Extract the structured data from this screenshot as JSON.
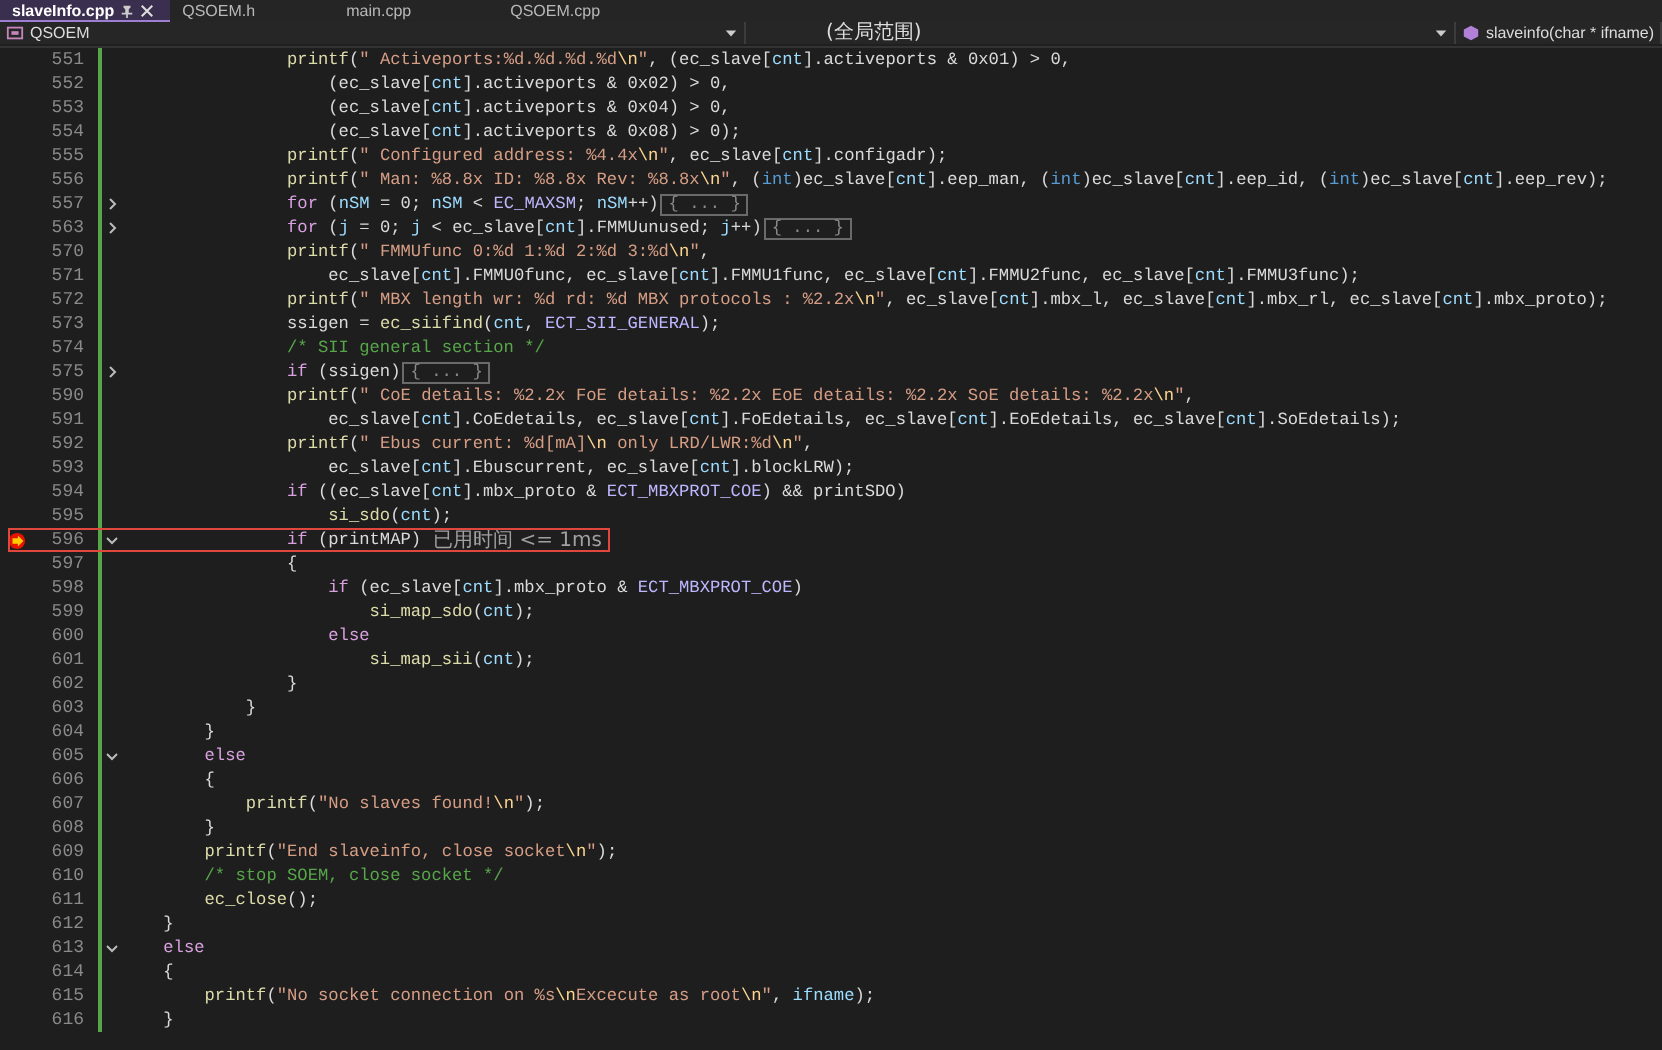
{
  "tabs": [
    {
      "label": "slaveInfo.cpp",
      "selected": true
    },
    {
      "label": "QSOEM.h",
      "selected": false
    },
    {
      "label": "main.cpp",
      "selected": false
    },
    {
      "label": "QSOEM.cpp",
      "selected": false
    }
  ],
  "navigation_bar": {
    "project": "QSOEM",
    "scope": "(全局范围)",
    "member": "slaveinfo(char * ifname)"
  },
  "editor": {
    "lines": [
      {
        "number": "551",
        "breakpoint": false,
        "highlighted": false,
        "segments": [
          {
            "text": "                printf",
            "kind": "f"
          },
          {
            "text": "(",
            "kind": "p"
          },
          {
            "text": "\" Activeports:%d.%d.%d.%d",
            "kind": "s"
          },
          {
            "text": "\\n",
            "kind": "e"
          },
          {
            "text": "\"",
            "kind": "s"
          },
          {
            "text": ", (ec_slave[",
            "kind": "p"
          },
          {
            "text": "cnt",
            "kind": "v"
          },
          {
            "text": "].activeports & 0x01) > 0,",
            "kind": "p"
          }
        ]
      },
      {
        "number": "552",
        "breakpoint": false,
        "highlighted": false,
        "segments": [
          {
            "text": "                    (ec_slave[",
            "kind": "p"
          },
          {
            "text": "cnt",
            "kind": "v"
          },
          {
            "text": "].activeports & 0x02) > 0,",
            "kind": "p"
          }
        ]
      },
      {
        "number": "553",
        "breakpoint": false,
        "highlighted": false,
        "segments": [
          {
            "text": "                    (ec_slave[",
            "kind": "p"
          },
          {
            "text": "cnt",
            "kind": "v"
          },
          {
            "text": "].activeports & 0x04) > 0,",
            "kind": "p"
          }
        ]
      },
      {
        "number": "554",
        "breakpoint": false,
        "highlighted": false,
        "segments": [
          {
            "text": "                    (ec_slave[",
            "kind": "p"
          },
          {
            "text": "cnt",
            "kind": "v"
          },
          {
            "text": "].activeports & 0x08) > 0);",
            "kind": "p"
          }
        ]
      },
      {
        "number": "555",
        "breakpoint": false,
        "highlighted": false,
        "segments": [
          {
            "text": "                printf",
            "kind": "f"
          },
          {
            "text": "(",
            "kind": "p"
          },
          {
            "text": "\" Configured address: %4.4x",
            "kind": "s"
          },
          {
            "text": "\\n",
            "kind": "e"
          },
          {
            "text": "\"",
            "kind": "s"
          },
          {
            "text": ", ec_slave[",
            "kind": "p"
          },
          {
            "text": "cnt",
            "kind": "v"
          },
          {
            "text": "].configadr);",
            "kind": "p"
          }
        ]
      },
      {
        "number": "556",
        "breakpoint": false,
        "highlighted": false,
        "segments": [
          {
            "text": "                printf",
            "kind": "f"
          },
          {
            "text": "(",
            "kind": "p"
          },
          {
            "text": "\" Man: %8.8x ID: %8.8x Rev: %8.8x",
            "kind": "s"
          },
          {
            "text": "\\n",
            "kind": "e"
          },
          {
            "text": "\"",
            "kind": "s"
          },
          {
            "text": ", (",
            "kind": "p"
          },
          {
            "text": "int",
            "kind": "t"
          },
          {
            "text": ")ec_slave[",
            "kind": "p"
          },
          {
            "text": "cnt",
            "kind": "v"
          },
          {
            "text": "].eep_man, (",
            "kind": "p"
          },
          {
            "text": "int",
            "kind": "t"
          },
          {
            "text": ")ec_slave[",
            "kind": "p"
          },
          {
            "text": "cnt",
            "kind": "v"
          },
          {
            "text": "].eep_id, (",
            "kind": "p"
          },
          {
            "text": "int",
            "kind": "t"
          },
          {
            "text": ")ec_slave[",
            "kind": "p"
          },
          {
            "text": "cnt",
            "kind": "v"
          },
          {
            "text": "].eep_rev);",
            "kind": "p"
          }
        ]
      },
      {
        "number": "557",
        "collapsed": true,
        "breakpoint": false,
        "highlighted": false,
        "segments": [
          {
            "text": "                for",
            "kind": "k"
          },
          {
            "text": " (",
            "kind": "p"
          },
          {
            "text": "nSM",
            "kind": "v"
          },
          {
            "text": " = 0; ",
            "kind": "p"
          },
          {
            "text": "nSM",
            "kind": "v"
          },
          {
            "text": " < ",
            "kind": "p"
          },
          {
            "text": "EC_MAXSM",
            "kind": "m"
          },
          {
            "text": "; ",
            "kind": "p"
          },
          {
            "text": "nSM",
            "kind": "v"
          },
          {
            "text": "++)",
            "kind": "p"
          },
          {
            "text": "{ ... }",
            "kind": "collapsed"
          }
        ]
      },
      {
        "number": "563",
        "collapsed": true,
        "breakpoint": false,
        "highlighted": false,
        "segments": [
          {
            "text": "                for",
            "kind": "k"
          },
          {
            "text": " (",
            "kind": "p"
          },
          {
            "text": "j",
            "kind": "v"
          },
          {
            "text": " = 0; ",
            "kind": "p"
          },
          {
            "text": "j",
            "kind": "v"
          },
          {
            "text": " < ec_slave[",
            "kind": "p"
          },
          {
            "text": "cnt",
            "kind": "v"
          },
          {
            "text": "].FMMUunused; ",
            "kind": "p"
          },
          {
            "text": "j",
            "kind": "v"
          },
          {
            "text": "++)",
            "kind": "p"
          },
          {
            "text": "{ ... }",
            "kind": "collapsed"
          }
        ]
      },
      {
        "number": "570",
        "breakpoint": false,
        "highlighted": false,
        "segments": [
          {
            "text": "                printf",
            "kind": "f"
          },
          {
            "text": "(",
            "kind": "p"
          },
          {
            "text": "\" FMMUfunc 0:%d 1:%d 2:%d 3:%d",
            "kind": "s"
          },
          {
            "text": "\\n",
            "kind": "e"
          },
          {
            "text": "\"",
            "kind": "s"
          },
          {
            "text": ",",
            "kind": "p"
          }
        ]
      },
      {
        "number": "571",
        "breakpoint": false,
        "highlighted": false,
        "segments": [
          {
            "text": "                    ec_slave[",
            "kind": "p"
          },
          {
            "text": "cnt",
            "kind": "v"
          },
          {
            "text": "].FMMU0func, ec_slave[",
            "kind": "p"
          },
          {
            "text": "cnt",
            "kind": "v"
          },
          {
            "text": "].FMMU1func, ec_slave[",
            "kind": "p"
          },
          {
            "text": "cnt",
            "kind": "v"
          },
          {
            "text": "].FMMU2func, ec_slave[",
            "kind": "p"
          },
          {
            "text": "cnt",
            "kind": "v"
          },
          {
            "text": "].FMMU3func);",
            "kind": "p"
          }
        ]
      },
      {
        "number": "572",
        "breakpoint": false,
        "highlighted": false,
        "segments": [
          {
            "text": "                printf",
            "kind": "f"
          },
          {
            "text": "(",
            "kind": "p"
          },
          {
            "text": "\" MBX length wr: %d rd: %d MBX protocols : %2.2x",
            "kind": "s"
          },
          {
            "text": "\\n",
            "kind": "e"
          },
          {
            "text": "\"",
            "kind": "s"
          },
          {
            "text": ", ec_slave[",
            "kind": "p"
          },
          {
            "text": "cnt",
            "kind": "v"
          },
          {
            "text": "].mbx_l, ec_slave[",
            "kind": "p"
          },
          {
            "text": "cnt",
            "kind": "v"
          },
          {
            "text": "].mbx_rl, ec_slave[",
            "kind": "p"
          },
          {
            "text": "cnt",
            "kind": "v"
          },
          {
            "text": "].mbx_proto);",
            "kind": "p"
          }
        ]
      },
      {
        "number": "573",
        "breakpoint": false,
        "highlighted": false,
        "segments": [
          {
            "text": "                ssigen = ",
            "kind": "p"
          },
          {
            "text": "ec_siifind",
            "kind": "f"
          },
          {
            "text": "(",
            "kind": "p"
          },
          {
            "text": "cnt",
            "kind": "v"
          },
          {
            "text": ", ",
            "kind": "p"
          },
          {
            "text": "ECT_SII_GENERAL",
            "kind": "m"
          },
          {
            "text": ");",
            "kind": "p"
          }
        ]
      },
      {
        "number": "574",
        "breakpoint": false,
        "highlighted": false,
        "segments": [
          {
            "text": "                /* SII general section */",
            "kind": "c"
          }
        ]
      },
      {
        "number": "575",
        "collapsed": true,
        "breakpoint": false,
        "highlighted": false,
        "segments": [
          {
            "text": "                if",
            "kind": "k"
          },
          {
            "text": " (ssigen)",
            "kind": "p"
          },
          {
            "text": "{ ... }",
            "kind": "collapsed"
          }
        ]
      },
      {
        "number": "590",
        "breakpoint": false,
        "highlighted": false,
        "segments": [
          {
            "text": "                printf",
            "kind": "f"
          },
          {
            "text": "(",
            "kind": "p"
          },
          {
            "text": "\" CoE details: %2.2x FoE details: %2.2x EoE details: %2.2x SoE details: %2.2x",
            "kind": "s"
          },
          {
            "text": "\\n",
            "kind": "e"
          },
          {
            "text": "\"",
            "kind": "s"
          },
          {
            "text": ",",
            "kind": "p"
          }
        ]
      },
      {
        "number": "591",
        "breakpoint": false,
        "highlighted": false,
        "segments": [
          {
            "text": "                    ec_slave[",
            "kind": "p"
          },
          {
            "text": "cnt",
            "kind": "v"
          },
          {
            "text": "].CoEdetails, ec_slave[",
            "kind": "p"
          },
          {
            "text": "cnt",
            "kind": "v"
          },
          {
            "text": "].FoEdetails, ec_slave[",
            "kind": "p"
          },
          {
            "text": "cnt",
            "kind": "v"
          },
          {
            "text": "].EoEdetails, ec_slave[",
            "kind": "p"
          },
          {
            "text": "cnt",
            "kind": "v"
          },
          {
            "text": "].SoEdetails);",
            "kind": "p"
          }
        ]
      },
      {
        "number": "592",
        "breakpoint": false,
        "highlighted": false,
        "segments": [
          {
            "text": "                printf",
            "kind": "f"
          },
          {
            "text": "(",
            "kind": "p"
          },
          {
            "text": "\" Ebus current: %d[mA]",
            "kind": "s"
          },
          {
            "text": "\\n",
            "kind": "e"
          },
          {
            "text": " only LRD/LWR:%d",
            "kind": "s"
          },
          {
            "text": "\\n",
            "kind": "e"
          },
          {
            "text": "\"",
            "kind": "s"
          },
          {
            "text": ",",
            "kind": "p"
          }
        ]
      },
      {
        "number": "593",
        "breakpoint": false,
        "highlighted": false,
        "segments": [
          {
            "text": "                    ec_slave[",
            "kind": "p"
          },
          {
            "text": "cnt",
            "kind": "v"
          },
          {
            "text": "].Ebuscurrent, ec_slave[",
            "kind": "p"
          },
          {
            "text": "cnt",
            "kind": "v"
          },
          {
            "text": "].blockLRW);",
            "kind": "p"
          }
        ]
      },
      {
        "number": "594",
        "breakpoint": false,
        "highlighted": false,
        "segments": [
          {
            "text": "                if",
            "kind": "k"
          },
          {
            "text": " ((ec_slave[",
            "kind": "p"
          },
          {
            "text": "cnt",
            "kind": "v"
          },
          {
            "text": "].mbx_proto & ",
            "kind": "p"
          },
          {
            "text": "ECT_MBXPROT_COE",
            "kind": "m"
          },
          {
            "text": ") && printSDO)",
            "kind": "p"
          }
        ]
      },
      {
        "number": "595",
        "breakpoint": false,
        "highlighted": false,
        "segments": [
          {
            "text": "                    si_sdo",
            "kind": "f"
          },
          {
            "text": "(",
            "kind": "p"
          },
          {
            "text": "cnt",
            "kind": "v"
          },
          {
            "text": ");",
            "kind": "p"
          }
        ]
      },
      {
        "number": "596",
        "collapsed": false,
        "breakpoint": true,
        "highlighted": true,
        "elapsed_hint": "已用时间 <= 1ms",
        "segments": [
          {
            "text": "                if",
            "kind": "k"
          },
          {
            "text": " (printMAP)",
            "kind": "p"
          }
        ]
      },
      {
        "number": "597",
        "breakpoint": false,
        "highlighted": false,
        "segments": [
          {
            "text": "                {",
            "kind": "p"
          }
        ]
      },
      {
        "number": "598",
        "breakpoint": false,
        "highlighted": false,
        "segments": [
          {
            "text": "                    if",
            "kind": "k"
          },
          {
            "text": " (ec_slave[",
            "kind": "p"
          },
          {
            "text": "cnt",
            "kind": "v"
          },
          {
            "text": "].mbx_proto & ",
            "kind": "p"
          },
          {
            "text": "ECT_MBXPROT_COE",
            "kind": "m"
          },
          {
            "text": ")",
            "kind": "p"
          }
        ]
      },
      {
        "number": "599",
        "breakpoint": false,
        "highlighted": false,
        "segments": [
          {
            "text": "                        si_map_sdo",
            "kind": "f"
          },
          {
            "text": "(",
            "kind": "p"
          },
          {
            "text": "cnt",
            "kind": "v"
          },
          {
            "text": ");",
            "kind": "p"
          }
        ]
      },
      {
        "number": "600",
        "breakpoint": false,
        "highlighted": false,
        "segments": [
          {
            "text": "                    else",
            "kind": "k"
          }
        ]
      },
      {
        "number": "601",
        "breakpoint": false,
        "highlighted": false,
        "segments": [
          {
            "text": "                        si_map_sii",
            "kind": "f"
          },
          {
            "text": "(",
            "kind": "p"
          },
          {
            "text": "cnt",
            "kind": "v"
          },
          {
            "text": ");",
            "kind": "p"
          }
        ]
      },
      {
        "number": "602",
        "breakpoint": false,
        "highlighted": false,
        "segments": [
          {
            "text": "                }",
            "kind": "p"
          }
        ]
      },
      {
        "number": "603",
        "breakpoint": false,
        "highlighted": false,
        "segments": [
          {
            "text": "            }",
            "kind": "p"
          }
        ]
      },
      {
        "number": "604",
        "breakpoint": false,
        "highlighted": false,
        "segments": [
          {
            "text": "        }",
            "kind": "p"
          }
        ]
      },
      {
        "number": "605",
        "collapsed": false,
        "breakpoint": false,
        "highlighted": false,
        "segments": [
          {
            "text": "        else",
            "kind": "k"
          }
        ]
      },
      {
        "number": "606",
        "breakpoint": false,
        "highlighted": false,
        "segments": [
          {
            "text": "        {",
            "kind": "p"
          }
        ]
      },
      {
        "number": "607",
        "breakpoint": false,
        "highlighted": false,
        "segments": [
          {
            "text": "            printf",
            "kind": "f"
          },
          {
            "text": "(",
            "kind": "p"
          },
          {
            "text": "\"No slaves found!",
            "kind": "s"
          },
          {
            "text": "\\n",
            "kind": "e"
          },
          {
            "text": "\"",
            "kind": "s"
          },
          {
            "text": ");",
            "kind": "p"
          }
        ]
      },
      {
        "number": "608",
        "breakpoint": false,
        "highlighted": false,
        "segments": [
          {
            "text": "        }",
            "kind": "p"
          }
        ]
      },
      {
        "number": "609",
        "breakpoint": false,
        "highlighted": false,
        "segments": [
          {
            "text": "        printf",
            "kind": "f"
          },
          {
            "text": "(",
            "kind": "p"
          },
          {
            "text": "\"End slaveinfo, close socket",
            "kind": "s"
          },
          {
            "text": "\\n",
            "kind": "e"
          },
          {
            "text": "\"",
            "kind": "s"
          },
          {
            "text": ");",
            "kind": "p"
          }
        ]
      },
      {
        "number": "610",
        "breakpoint": false,
        "highlighted": false,
        "segments": [
          {
            "text": "        /* stop SOEM, close socket */",
            "kind": "c"
          }
        ]
      },
      {
        "number": "611",
        "breakpoint": false,
        "highlighted": false,
        "segments": [
          {
            "text": "        ec_close",
            "kind": "f"
          },
          {
            "text": "();",
            "kind": "p"
          }
        ]
      },
      {
        "number": "612",
        "breakpoint": false,
        "highlighted": false,
        "segments": [
          {
            "text": "    }",
            "kind": "p"
          }
        ]
      },
      {
        "number": "613",
        "collapsed": false,
        "breakpoint": false,
        "highlighted": false,
        "segments": [
          {
            "text": "    else",
            "kind": "k"
          }
        ]
      },
      {
        "number": "614",
        "breakpoint": false,
        "highlighted": false,
        "segments": [
          {
            "text": "    {",
            "kind": "p"
          }
        ]
      },
      {
        "number": "615",
        "breakpoint": false,
        "highlighted": false,
        "segments": [
          {
            "text": "        printf",
            "kind": "f"
          },
          {
            "text": "(",
            "kind": "p"
          },
          {
            "text": "\"No socket connection on %s",
            "kind": "s"
          },
          {
            "text": "\\n",
            "kind": "e"
          },
          {
            "text": "Excecute as root",
            "kind": "s"
          },
          {
            "text": "\\n",
            "kind": "e"
          },
          {
            "text": "\"",
            "kind": "s"
          },
          {
            "text": ", ",
            "kind": "p"
          },
          {
            "text": "ifname",
            "kind": "v"
          },
          {
            "text": ");",
            "kind": "p"
          }
        ]
      },
      {
        "number": "616",
        "breakpoint": false,
        "highlighted": false,
        "segments": [
          {
            "text": "    }",
            "kind": "p"
          }
        ]
      }
    ]
  }
}
